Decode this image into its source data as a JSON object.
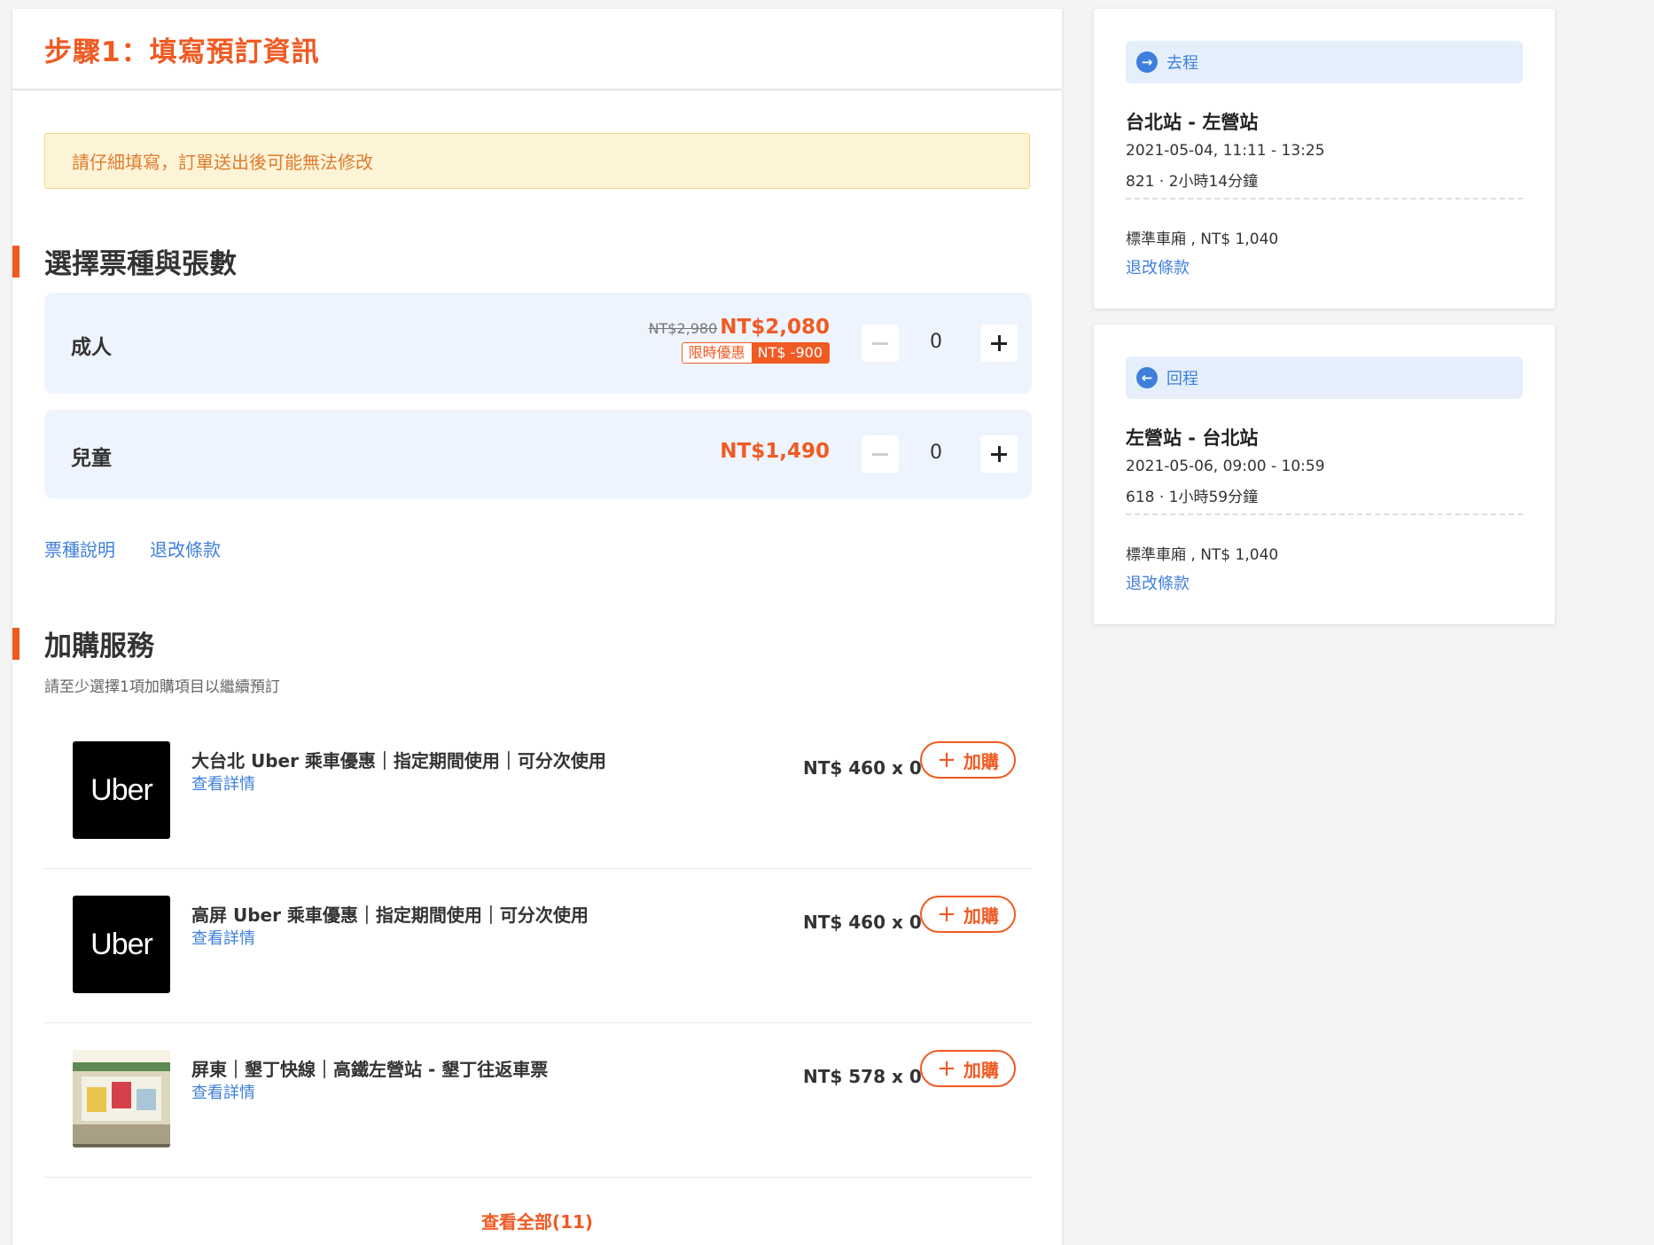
{
  "step": {
    "title": "步驟1：填寫預訂資訊"
  },
  "notice": {
    "text": "請仔細填寫，訂單送出後可能無法修改"
  },
  "tickets": {
    "section_title": "選擇票種與張數",
    "rows": [
      {
        "label": "成人",
        "old_price": "NT$2,980",
        "price": "NT$2,080",
        "promo_label": "限時優惠",
        "promo_value": "NT$ -900",
        "qty": "0"
      },
      {
        "label": "兒童",
        "price": "NT$1,490",
        "qty": "0"
      }
    ],
    "links": {
      "ticket_info": "票種說明",
      "refund_policy": "退改條款"
    }
  },
  "addons": {
    "section_title": "加購服務",
    "subtitle": "請至少選擇1項加購項目以繼續預訂",
    "items": [
      {
        "title": "大台北 Uber 乘車優惠｜指定期間使用｜可分次使用",
        "detail": "查看詳情",
        "price": "NT$ 460 x 0",
        "button": "加購",
        "logo": "Uber"
      },
      {
        "title": "高屏 Uber 乘車優惠｜指定期間使用｜可分次使用",
        "detail": "查看詳情",
        "price": "NT$ 460 x 0",
        "button": "加購",
        "logo": "Uber"
      },
      {
        "title": "屏東｜墾丁快線｜高鐵左營站 - 墾丁往返車票",
        "detail": "查看詳情",
        "price": "NT$ 578 x 0",
        "button": "加購"
      }
    ],
    "view_all": "查看全部(11)"
  },
  "trips": [
    {
      "direction": "去程",
      "route": "台北站 - 左營站",
      "datetime": "2021-05-04, 11:11 - 13:25",
      "train": "821 · 2小時14分鐘",
      "car_price": "標準車廂 , NT$ 1,040",
      "link": "退改條款"
    },
    {
      "direction": "回程",
      "route": "左營站 - 台北站",
      "datetime": "2021-05-06, 09:00 - 10:59",
      "train": "618 · 1小時59分鐘",
      "car_price": "標準車廂 , NT$ 1,040",
      "link": "退改條款"
    }
  ],
  "colors": {
    "accent": "#f05a23",
    "link": "#3f7fdc",
    "ticket_bg": "#eef4fd",
    "notice_bg": "#fdf4d7"
  },
  "icons": {
    "outbound": "arrow-right-circle-icon",
    "return": "arrow-left-circle-icon",
    "decrease": "minus-icon",
    "increase": "plus-icon"
  }
}
